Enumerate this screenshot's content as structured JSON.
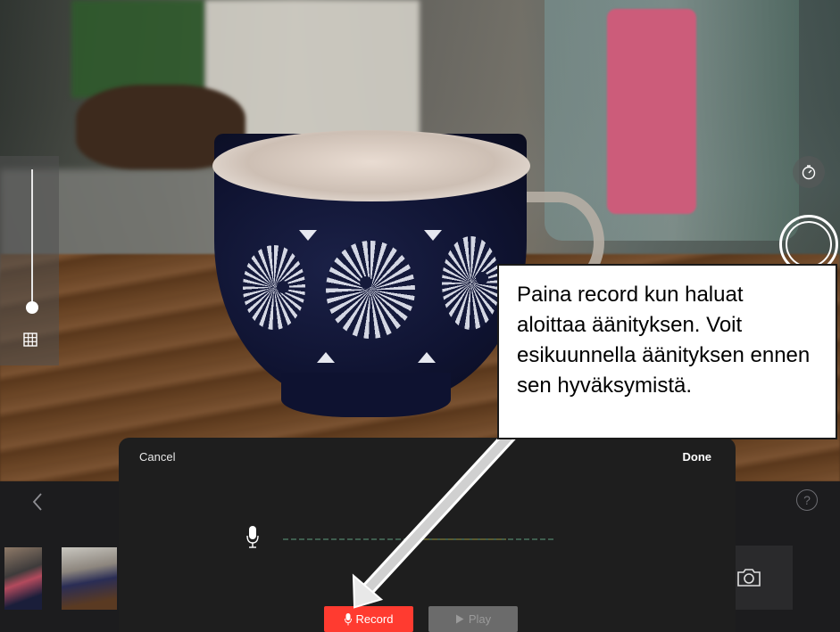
{
  "viewfinder": {
    "scene": "camera-preview"
  },
  "camera_controls": {
    "timer_icon": "timer-icon",
    "shutter_icon": "shutter-button",
    "grid_icon": "grid-icon"
  },
  "toolbar": {
    "back_icon": "chevron-left-icon",
    "help_label": "?",
    "camera_icon": "camera-icon"
  },
  "voiceover": {
    "cancel_label": "Cancel",
    "done_label": "Done",
    "record_label": "Record",
    "play_label": "Play",
    "record_color": "#ff3b30"
  },
  "callout": {
    "text": "Paina record kun haluat aloittaa äänityksen. Voit esikuunnella äänityksen ennen sen hyväksymistä."
  }
}
